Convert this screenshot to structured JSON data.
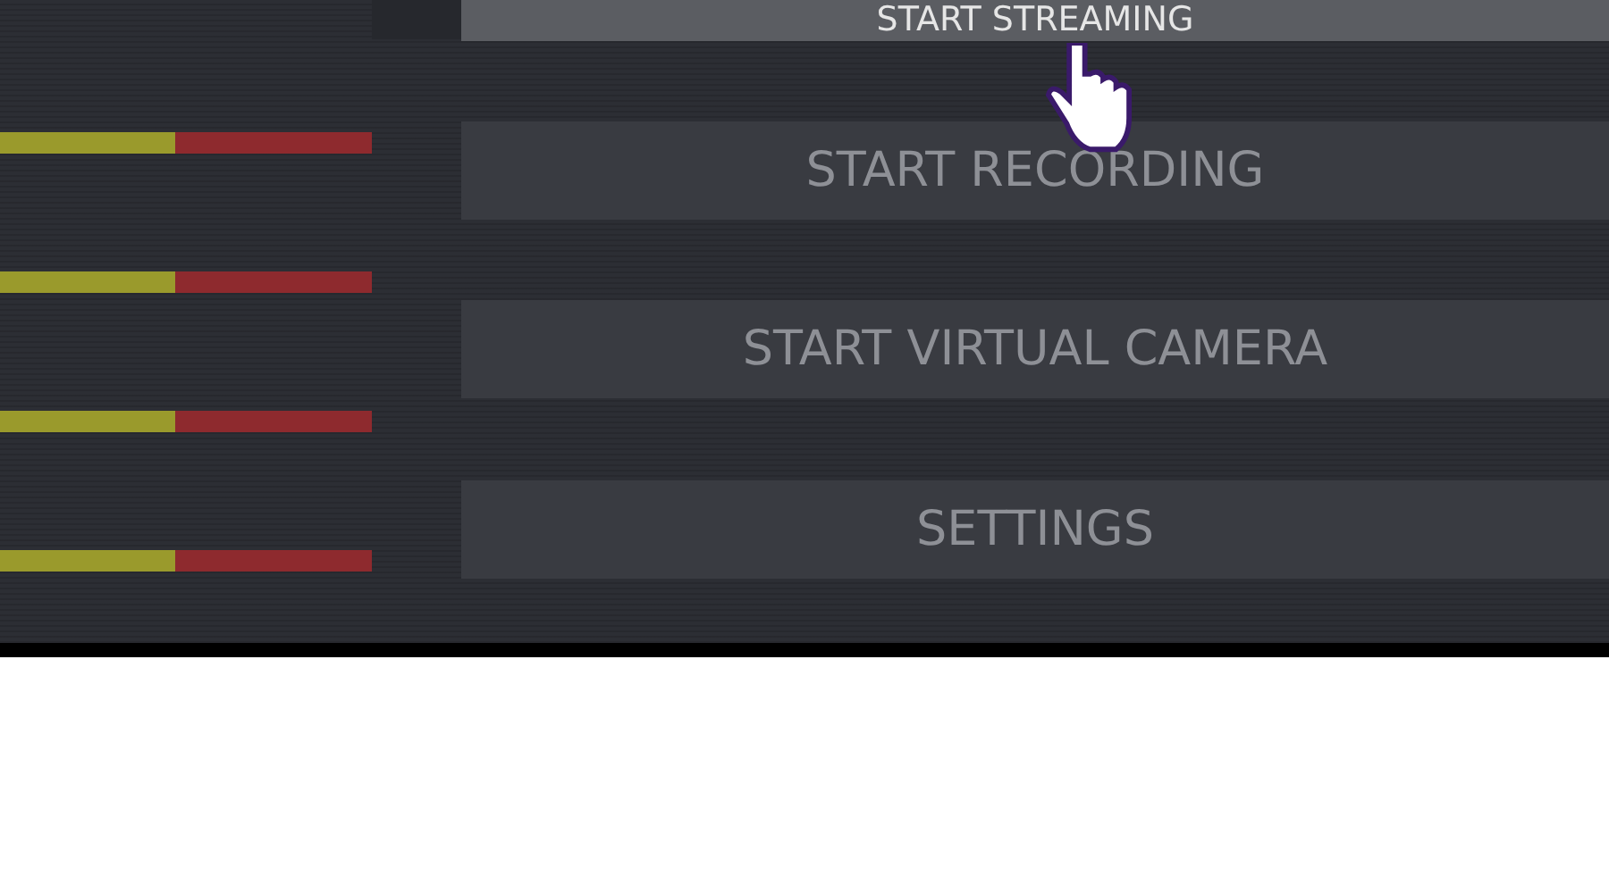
{
  "meters": [
    {
      "kind": "meter"
    },
    {
      "kind": "meter"
    },
    {
      "kind": "meter"
    },
    {
      "kind": "meter"
    }
  ],
  "controls": [
    {
      "label": "START STREAMING",
      "hovered": true
    },
    {
      "label": "START RECORDING",
      "hovered": false
    },
    {
      "label": "START VIRTUAL CAMERA",
      "hovered": false
    },
    {
      "label": "SETTINGS",
      "hovered": false
    }
  ]
}
